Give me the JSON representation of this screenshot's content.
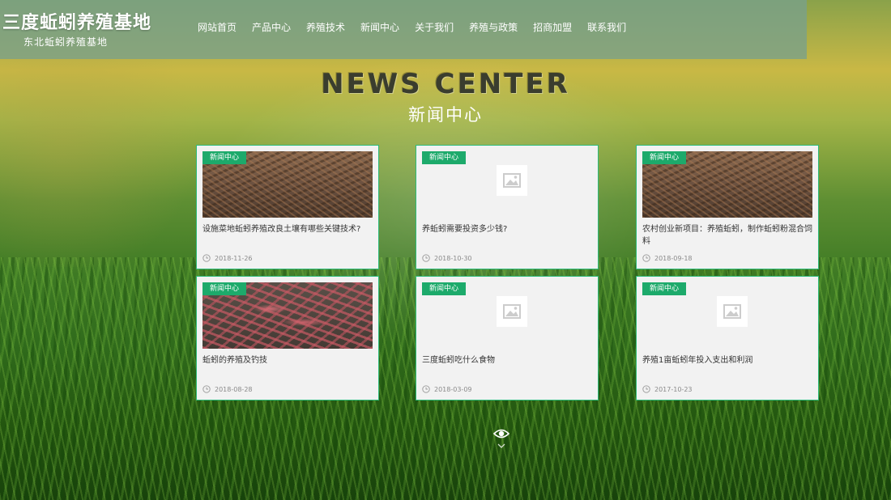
{
  "header": {
    "logo_title": "三度蚯蚓养殖基地",
    "logo_subtitle": "东北蚯蚓养殖基地",
    "nav": [
      "网站首页",
      "产品中心",
      "养殖技术",
      "新闻中心",
      "关于我们",
      "养殖与政策",
      "招商加盟",
      "联系我们"
    ]
  },
  "section": {
    "title_en": "NEWS CENTER",
    "title_cn": "新闻中心"
  },
  "news": [
    {
      "badge": "新闻中心",
      "title": "设施菜地蚯蚓养殖改良土壤有哪些关键技术?",
      "date": "2018-11-26",
      "image": "soil-photo"
    },
    {
      "badge": "新闻中心",
      "title": "养蚯蚓需要投资多少钱?",
      "date": "2018-10-30",
      "image": "image-placeholder-icon"
    },
    {
      "badge": "新闻中心",
      "title": "农村创业新项目：养殖蚯蚓，制作蚯蚓粉混合饲料",
      "date": "2018-09-18",
      "image": "soil-photo"
    },
    {
      "badge": "新闻中心",
      "title": "蚯蚓的养殖及钓技",
      "date": "2018-08-28",
      "image": "worms-photo"
    },
    {
      "badge": "新闻中心",
      "title": "三度蚯蚓吃什么食物",
      "date": "2018-03-09",
      "image": "image-placeholder-icon"
    },
    {
      "badge": "新闻中心",
      "title": "养殖1亩蚯蚓年投入支出和利润",
      "date": "2017-10-23",
      "image": "image-placeholder-icon"
    }
  ],
  "icons": {
    "date": "clock-icon",
    "scroll": "eye-icon"
  },
  "colors": {
    "accent": "#1daa6b",
    "card_border": "#2dbb7a"
  }
}
